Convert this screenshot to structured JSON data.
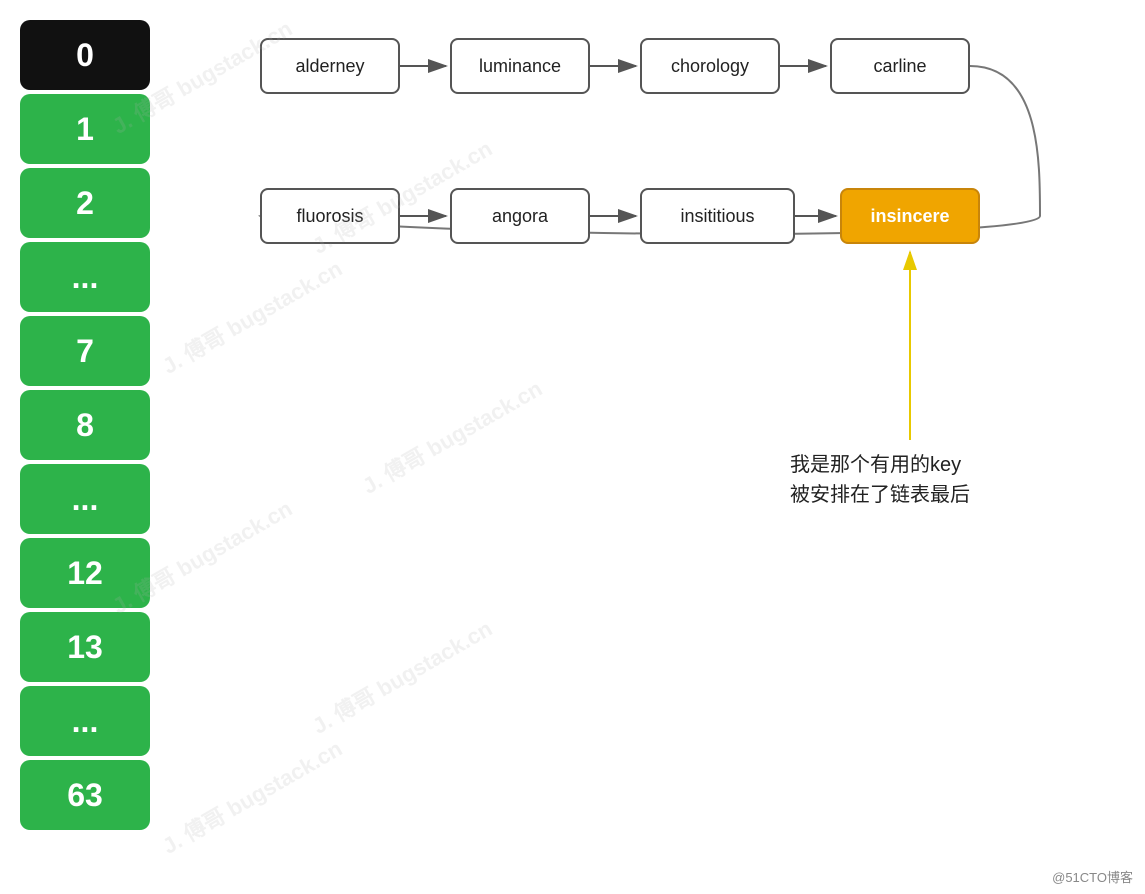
{
  "sidebar": {
    "items": [
      {
        "label": "0",
        "style": "black"
      },
      {
        "label": "1",
        "style": "green"
      },
      {
        "label": "2",
        "style": "green"
      },
      {
        "label": "...",
        "style": "green"
      },
      {
        "label": "7",
        "style": "green"
      },
      {
        "label": "8",
        "style": "green"
      },
      {
        "label": "...",
        "style": "green"
      },
      {
        "label": "12",
        "style": "green"
      },
      {
        "label": "13",
        "style": "green"
      },
      {
        "label": "...",
        "style": "green"
      },
      {
        "label": "63",
        "style": "green"
      }
    ]
  },
  "nodes": {
    "row1": [
      {
        "id": "alderney",
        "label": "alderney"
      },
      {
        "id": "luminance",
        "label": "luminance"
      },
      {
        "id": "chorology",
        "label": "chorology"
      },
      {
        "id": "carline",
        "label": "carline"
      }
    ],
    "row2": [
      {
        "id": "fluorosis",
        "label": "fluorosis"
      },
      {
        "id": "angora",
        "label": "angora"
      },
      {
        "id": "insititious",
        "label": "insititious"
      },
      {
        "id": "insincere",
        "label": "insincere",
        "highlighted": true
      }
    ]
  },
  "annotation": {
    "line1": "我是那个有用的key",
    "line2": "被安排在了链表最后"
  },
  "copyright": "@51CTO博客"
}
